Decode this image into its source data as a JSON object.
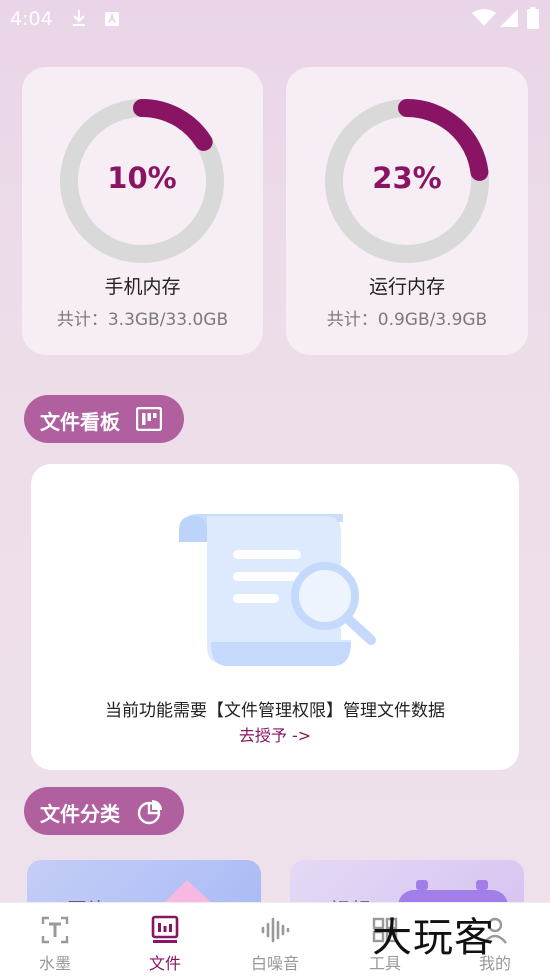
{
  "status_bar": {
    "time": "4:04"
  },
  "storage": {
    "phone": {
      "percent_label": "10%",
      "percent_value": 10,
      "title": "手机内存",
      "detail": "共计：3.3GB/33.0GB"
    },
    "ram": {
      "percent_label": "23%",
      "percent_value": 23,
      "title": "运行内存",
      "detail": "共计：0.9GB/3.9GB"
    }
  },
  "file_board": {
    "header_label": "文件看板",
    "message": "当前功能需要【文件管理权限】管理文件数据",
    "action_link": "去授予 ->"
  },
  "file_category": {
    "header_label": "文件分类",
    "items": [
      {
        "label": "图片"
      },
      {
        "label": "视频"
      }
    ]
  },
  "tab_bar": {
    "tabs": [
      {
        "label": "水墨",
        "icon": "text-icon"
      },
      {
        "label": "文件",
        "icon": "file-board-icon",
        "active": true
      },
      {
        "label": "白噪音",
        "icon": "waveform-icon"
      },
      {
        "label": "工具",
        "icon": "tools-icon"
      },
      {
        "label": "我的",
        "icon": "profile-icon"
      }
    ]
  },
  "watermark": "大玩客",
  "colors": {
    "accent": "#8a1464",
    "pill": "#b0609f",
    "ring_track": "#d9d9d9"
  }
}
